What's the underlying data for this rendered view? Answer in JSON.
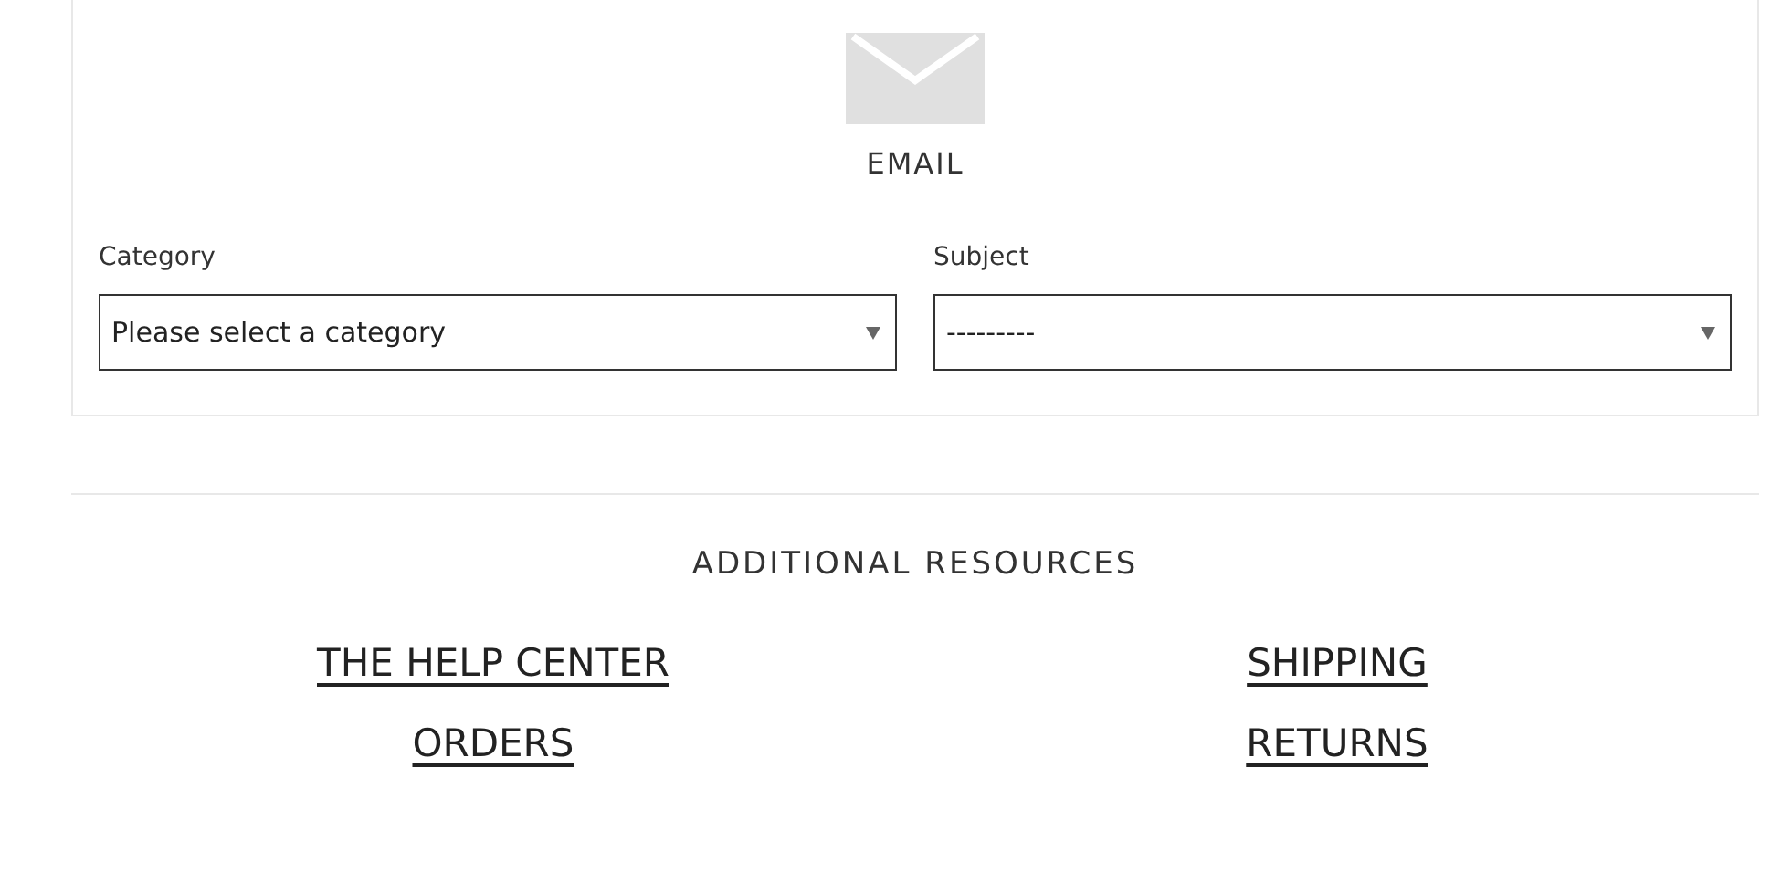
{
  "contact_card": {
    "method": "EMAIL",
    "fields": [
      {
        "label": "Category",
        "value": "Please select a category"
      },
      {
        "label": "Subject",
        "value": "---------"
      }
    ]
  },
  "resources": {
    "heading": "ADDITIONAL RESOURCES",
    "links": [
      {
        "label": "THE HELP CENTER"
      },
      {
        "label": "SHIPPING"
      },
      {
        "label": "ORDERS"
      },
      {
        "label": "RETURNS"
      }
    ]
  }
}
